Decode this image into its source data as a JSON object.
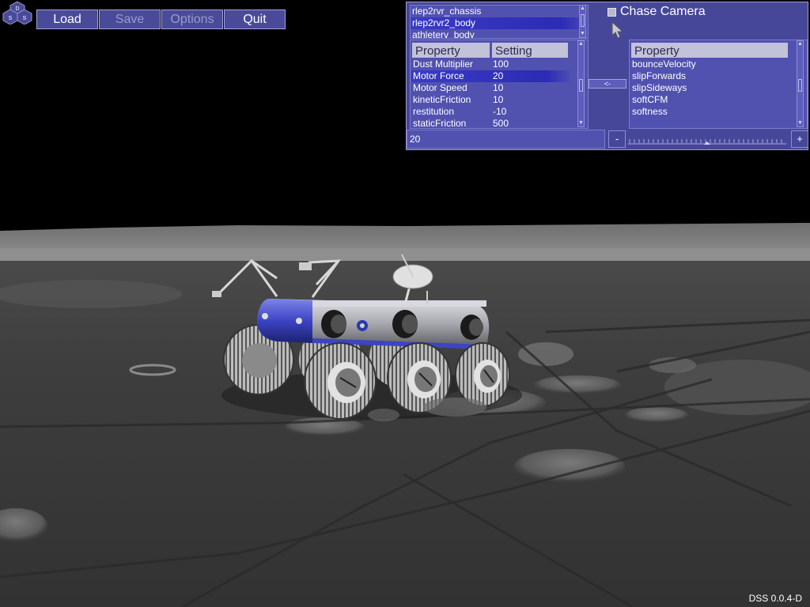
{
  "logo": {
    "letters": [
      "D",
      "S",
      "S"
    ]
  },
  "toolbar": {
    "buttons": [
      {
        "label": "Load"
      },
      {
        "label": "Save"
      },
      {
        "label": "Options"
      },
      {
        "label": "Quit"
      }
    ]
  },
  "object_list": {
    "items": [
      "rlep2rvr_chassis",
      "rlep2rvr2_body",
      "athleterv_body"
    ],
    "selected_index": 1
  },
  "chase_camera": {
    "label": "Chase Camera",
    "checked": false
  },
  "left_grid": {
    "header": [
      "Property",
      "Setting"
    ],
    "rows": [
      {
        "property": "Dust Multiplier",
        "setting": "100"
      },
      {
        "property": "Motor Force",
        "setting": "20"
      },
      {
        "property": "Motor Speed",
        "setting": "10"
      },
      {
        "property": "kineticFriction",
        "setting": "10"
      },
      {
        "property": "restitution",
        "setting": "-10"
      },
      {
        "property": "staticFriction",
        "setting": "500"
      }
    ],
    "selected_index": 1
  },
  "transfer_button": {
    "label": "<-"
  },
  "right_grid": {
    "header": "Property",
    "rows": [
      "bounceVelocity",
      "slipForwards",
      "slipSideways",
      "softCFM",
      "softness"
    ]
  },
  "value_editor": {
    "value": "20",
    "minus_label": "-",
    "plus_label": "+",
    "slider_level": 0.5
  },
  "version": "DSS 0.0.4-D",
  "colors": {
    "panel": "#47479a",
    "list_bg": "#5151b0",
    "selection": "#2b2bb6",
    "rover_blue": "#3e44c0",
    "rover_silver": "#b0b0b8"
  }
}
